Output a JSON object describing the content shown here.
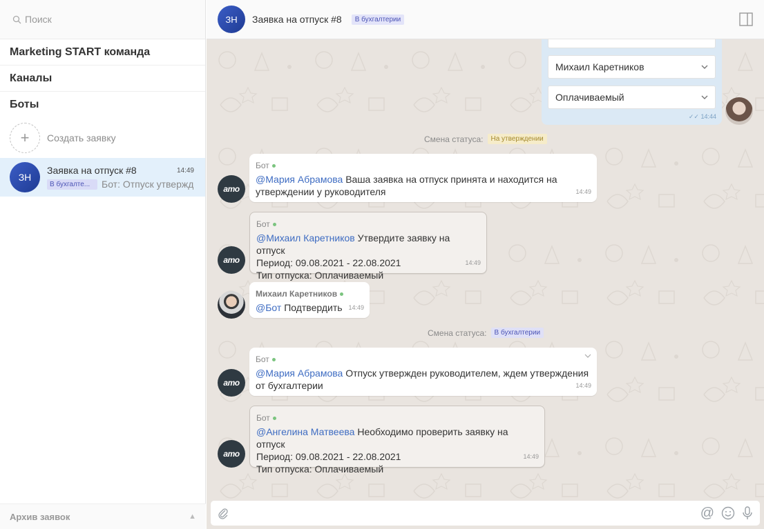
{
  "sidebar": {
    "search_placeholder": "Поиск",
    "sections": [
      "Marketing START команда",
      "Каналы",
      "Боты"
    ],
    "create_label": "Создать заявку",
    "chat": {
      "avatar": "ЗН",
      "title": "Заявка на отпуск #8",
      "time": "14:49",
      "badge": "В бухгалте...",
      "preview": "Бот: Отпуск утвержд"
    },
    "archive_label": "Архив заявок"
  },
  "header": {
    "avatar": "ЗН",
    "title": "Заявка на отпуск #8",
    "status": "В бухгалтерии"
  },
  "form": {
    "select_1": "Михаил Каретников",
    "select_2": "Оплачиваемый",
    "time": "14:44"
  },
  "status_changes": [
    {
      "label": "Смена статуса:",
      "status": "На утверждении",
      "bg": "#f6ecc9",
      "fg": "#a58a2e"
    },
    {
      "label": "Смена статуса:",
      "status": "В бухгалтерии",
      "bg": "#dfe0f7",
      "fg": "#4b53b5"
    }
  ],
  "messages": [
    {
      "sender": "Бот",
      "mention": "@Мария Абрамова",
      "text": "Ваша заявка на отпуск принята и находится на",
      "line2": "утверждении у руководителя",
      "time": "14:49"
    },
    {
      "sender": "Бот",
      "mention": "@Михаил Каретников",
      "text": "Утвердите заявку на отпуск",
      "line2": "Период: 09.08.2021 - 22.08.2021",
      "line3": "Тип отпуска: Оплачиваемый",
      "time": "14:49"
    },
    {
      "sender": "Михаил Каретников",
      "mention": "@Бот",
      "text": "Подтвердить",
      "time": "14:49"
    },
    {
      "sender": "Бот",
      "mention": "@Мария Абрамова",
      "text": "Отпуск утвержден руководителем, ждем утверждения",
      "line2": "от бухгалтерии",
      "time": "14:49"
    },
    {
      "sender": "Бот",
      "mention": "@Ангелина Матвеева",
      "text": "Необходимо проверить заявку на отпуск",
      "line2": "Период: 09.08.2021 - 22.08.2021",
      "line3": "Тип отпуска: Оплачиваемый",
      "time": "14:49"
    }
  ],
  "bot_avatar_text": "amo",
  "colors": {
    "accent": "#3e6cc2",
    "online": "#7bc47f",
    "selected_bg": "#e3f0fb"
  },
  "icons": [
    "search-icon",
    "plus-icon",
    "panel-toggle-icon",
    "chevron-down-icon",
    "paperclip-icon",
    "at-icon",
    "emoji-icon",
    "microphone-icon"
  ]
}
